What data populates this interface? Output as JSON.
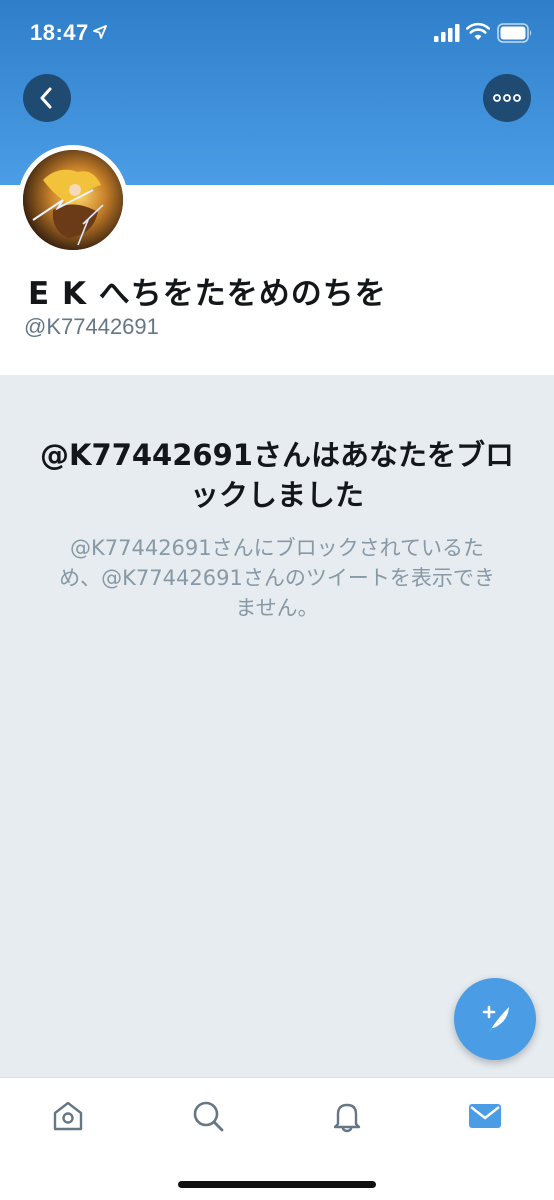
{
  "status_bar": {
    "time": "18:47"
  },
  "profile": {
    "display_name": "E K へちをたをめのちを",
    "handle": "@K77442691"
  },
  "blocked_notice": {
    "title": "@K77442691さんはあなたをブロックしました",
    "description": "@K77442691さんにブロックされているため、@K77442691さんのツイートを表示できません。"
  },
  "colors": {
    "header_blue": "#4b9de6",
    "accent": "#4a9de5",
    "background": "#e6ecf0",
    "secondary_text": "#8899a6"
  },
  "icons": {
    "back": "back-arrow-icon",
    "more": "more-dots-icon",
    "compose": "compose-tweet-icon",
    "home": "home-icon",
    "search": "search-icon",
    "notifications": "bell-icon",
    "messages": "mail-icon"
  },
  "tab_bar": {
    "active": "messages"
  }
}
